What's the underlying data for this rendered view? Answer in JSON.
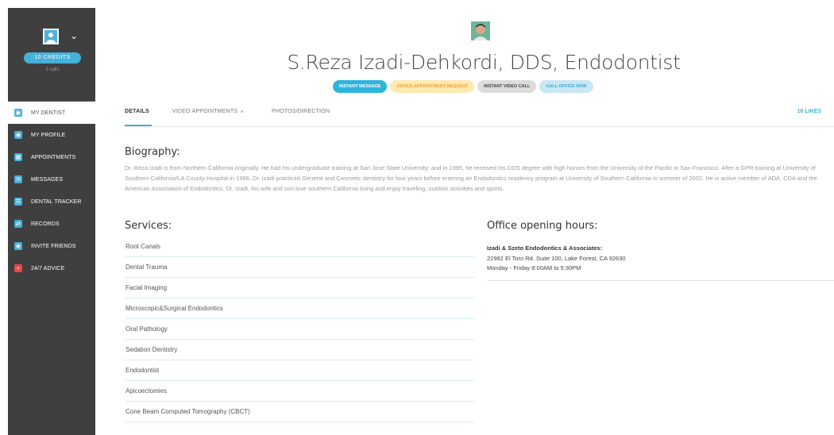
{
  "sidebar": {
    "credits": "10 CREDITS",
    "calls": "2 calls",
    "items": [
      {
        "label": "MY DENTIST",
        "icon": "tooth-icon"
      },
      {
        "label": "MY PROFILE",
        "icon": "profile-icon"
      },
      {
        "label": "APPOINTMENTS",
        "icon": "calendar-icon"
      },
      {
        "label": "MESSAGES",
        "icon": "mail-icon"
      },
      {
        "label": "DENTAL TRACKER",
        "icon": "tracker-icon"
      },
      {
        "label": "RECORDS",
        "icon": "records-icon"
      },
      {
        "label": "INVITE FRIENDS",
        "icon": "invite-icon"
      },
      {
        "label": "24/7 ADVICE",
        "icon": "medical-cross-icon"
      }
    ]
  },
  "profile": {
    "name": "S.Reza Izadi-Dehkordi, DDS, Endodontist"
  },
  "actions": {
    "instant_message": "INSTANT MESSAGE",
    "office_request": "OFFICE APPOINTMENT REQUEST",
    "video_call": "INSTANT VIDEO CALL",
    "call_office": "CALL OFFICE NOW"
  },
  "tabs": {
    "details": "DETAILS",
    "video": "VIDEO APPOINTMENTS",
    "photos": "PHOTOS/DIRECTION",
    "likes": "16 LIKES"
  },
  "biography": {
    "heading": "Biography:",
    "text": "Dr. Reza Izadi is from Northern California originally. He had his undergraduate training at San Jose State University; and in 1995, he received his DDS degree with high honors from the University of the Pacific in San Francisco. After a GPR training at University of Southern California/LA County Hospital in 1996, Dr. Izadi practiced General and Cosmetic dentistry for four years before entering an Endodontics residency program at University of Southern California in summer of 2002. He is active member of ADA, CDA and the American Association of Endodontics. Dr. Izadi, his wife and son love southern California living and enjoy traveling, outdoor activities and sports."
  },
  "services": {
    "heading": "Services:",
    "items": [
      "Root Canals",
      "Dental Trauma",
      "Facial Imaging",
      "Microscopic&Surgical Endodontics",
      "Oral Pathology",
      "Sedation Dentistry",
      "Endodontist",
      "Apicoectomies",
      "Cone Beam Computed Tomography (CBCT)"
    ]
  },
  "hours": {
    "heading": "Office opening hours:",
    "office_name": "Izadi & Szeto Endodontics & Associates:",
    "address": "22982 El Toro Rd. Suite 100, Lake Forest, CA 92630",
    "schedule": "Monday - Friday 8:00AM to 5:30PM"
  },
  "colors": {
    "accent": "#45b0d8",
    "sidebar": "#3f3f3f",
    "office_button": "#ffe9b0"
  }
}
